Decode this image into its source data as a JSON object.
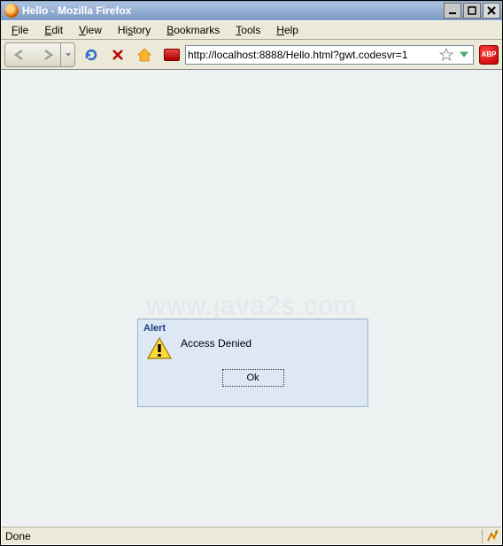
{
  "window": {
    "title": "Hello - Mozilla Firefox"
  },
  "menu": {
    "file": "File",
    "edit": "Edit",
    "view": "View",
    "history": "History",
    "bookmarks": "Bookmarks",
    "tools": "Tools",
    "help": "Help"
  },
  "toolbar": {
    "url": "http://localhost:8888/Hello.html?gwt.codesvr=1",
    "abp_label": "ABP"
  },
  "watermark": "www.java2s.com",
  "alert": {
    "title": "Alert",
    "message": "Access Denied",
    "ok_label": "Ok"
  },
  "status": {
    "text": "Done"
  }
}
